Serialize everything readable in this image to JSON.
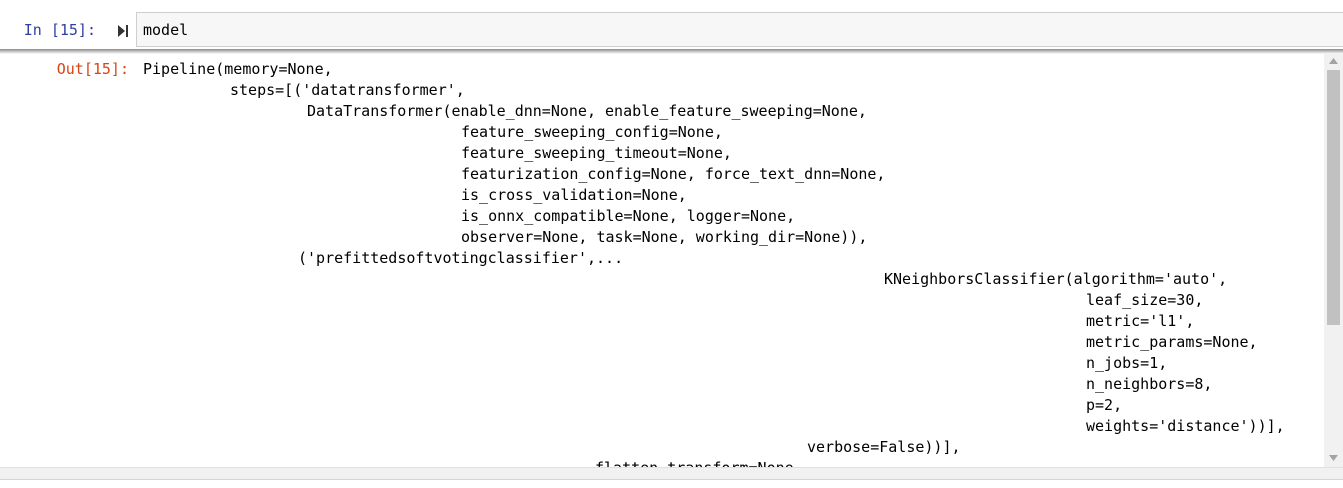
{
  "input_cell": {
    "prompt": "In [15]:",
    "code": "model",
    "run_icon": "run-cell-icon"
  },
  "output_cell": {
    "prompt": "Out[15]:",
    "lines": [
      "Pipeline(memory=None,",
      "steps=[('datatransformer',",
      "DataTransformer(enable_dnn=None, enable_feature_sweeping=None,",
      "feature_sweeping_config=None,",
      "feature_sweeping_timeout=None,",
      "featurization_config=None, force_text_dnn=None,",
      "is_cross_validation=None,",
      "is_onnx_compatible=None, logger=None,",
      "observer=None, task=None, working_dir=None)),",
      "('prefittedsoftvotingclassifier',...",
      "KNeighborsClassifier(algorithm='auto',",
      "leaf_size=30,",
      "metric='l1',",
      "metric_params=None,",
      "n_jobs=1,",
      "n_neighbors=8,",
      "p=2,",
      "weights='distance'))],",
      "verbose=False))],",
      "flatten_transform=None"
    ]
  },
  "scrollbar": {
    "up_icon": "scroll-up-arrow-icon",
    "down_icon": "scroll-down-arrow-icon"
  },
  "colors": {
    "in_prompt": "#303f9f",
    "out_prompt": "#d84315",
    "input_bg": "#f7f7f7"
  }
}
